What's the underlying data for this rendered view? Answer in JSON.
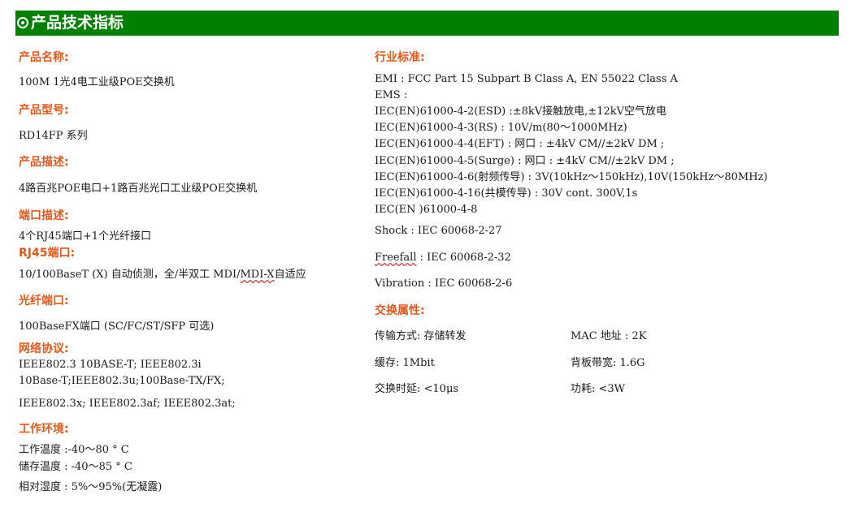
{
  "header": {
    "title": "产品技术指标"
  },
  "left": {
    "product_name": {
      "label": "产品名称:",
      "value": "100M 1光4电工业级POE交换机"
    },
    "model": {
      "label": "产品型号:",
      "value": "RD14FP 系列"
    },
    "description": {
      "label": "产品描述:",
      "value": "4路百兆POE电口+1路百兆光口工业级POE交换机"
    },
    "ports": {
      "label": "端口描述:",
      "value": "4个RJ45端口+1个光纤接口"
    },
    "rj45": {
      "label": "RJ45端口:",
      "value_pre": "10/100BaseT (X) 自动侦测，全/半双工 MDI/",
      "value_wavy": "MDI-X",
      "value_post": "自适应"
    },
    "fiber": {
      "label": "光纤端口:",
      "value": "100BaseFX端口 (SC/FC/ST/SFP 可选)"
    },
    "protocol": {
      "label": "网络协议:",
      "lines": [
        "IEEE802.3 10BASE-T; IEEE802.3i",
        "10Base-T;IEEE802.3u;100Base-TX/FX;",
        "IEEE802.3x;  IEEE802.3af;  IEEE802.3at;"
      ]
    },
    "environment": {
      "label": "工作环境:",
      "lines": [
        "工作温度 :-40～80 ° C",
        "储存温度 : -40～85 ° C",
        "相对湿度 : 5%～95%(无凝露)"
      ]
    }
  },
  "right": {
    "standards": {
      "label": "行业标准:",
      "lines": [
        "EMI : FCC Part 15 Subpart B Class A, EN 55022 Class A",
        "EMS :",
        "IEC(EN)61000-4-2(ESD) :±8kV接触放电,±12kV空气放电",
        "IEC(EN)61000-4-3(RS) : 10V/m(80～1000MHz)",
        "IEC(EN)61000-4-4(EFT) : 网口 : ±4kV CM//±2kV DM ;",
        "IEC(EN)61000-4-5(Surge) : 网口 : ±4kV CM//±2kV DM ;",
        "IEC(EN)61000-4-6(射频传导) : 3V(10kHz～150kHz),10V(150kHz～80MHz)",
        "IEC(EN)61000-4-16(共模传导) : 30V cont. 300V,1s",
        "IEC(EN )61000-4-8"
      ],
      "shock": "Shock : IEC 60068-2-27",
      "freefall_word": "Freefall",
      "freefall_rest": " : IEC 60068-2-32",
      "vibration": "Vibration : IEC 60068-2-6"
    },
    "switching": {
      "label": "交换属性:",
      "transfer": "传输方式: 存储转发",
      "mac": "MAC 地址 : 2K",
      "buffer": "缓存: 1Mbit",
      "backplane": "背板带宽: 1.6G",
      "latency": "交换时延: <10μs",
      "power": "功耗: <3W"
    }
  }
}
